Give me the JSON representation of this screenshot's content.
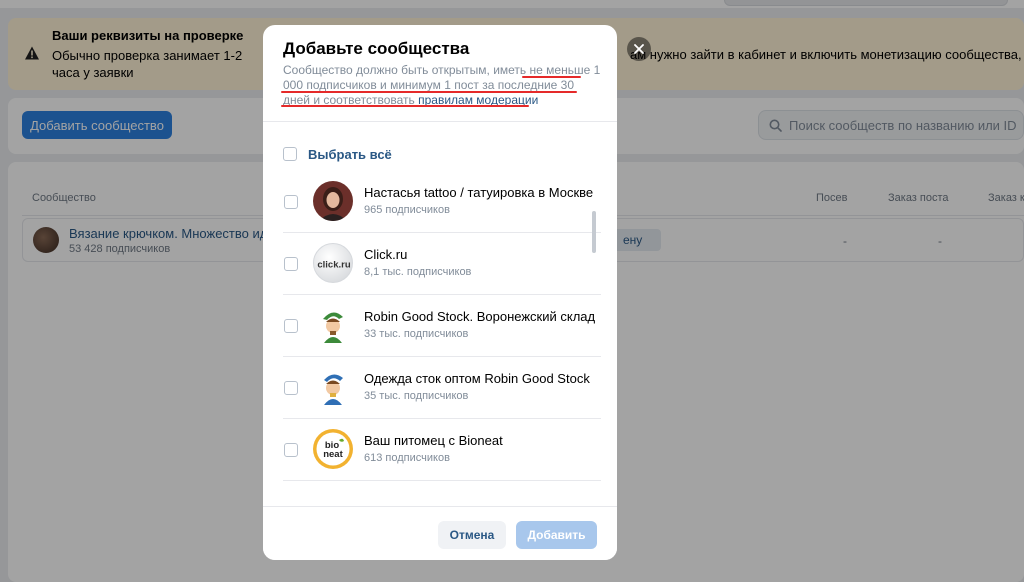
{
  "alert": {
    "title": "Ваши реквизиты на проверке",
    "body": "Обычно проверка занимает 1-2 часа у заявки",
    "body_right": "ам нужно зайти в кабинет и включить монетизацию сообщества, чтобы п"
  },
  "toolbar": {
    "add_label": "Добавить сообщество",
    "search_placeholder": "Поиск сообществ по названию или ID"
  },
  "table": {
    "headers": {
      "community": "Сообщество",
      "sowing": "Посев",
      "order_post": "Заказ поста",
      "order_more": "Заказ к"
    },
    "row": {
      "name": "Вязание крючком. Множество идей",
      "subs": "53 428 подписчиков",
      "tag": "ену",
      "dash": "-"
    }
  },
  "modal": {
    "title": "Добавьте сообщества",
    "desc_text": "Сообщество должно быть открытым, иметь не меньше 1 000 подписчиков и минимум 1 пост за последние 30 дней и соответствовать ",
    "desc_link": "правилам модерации",
    "select_all": "Выбрать всё",
    "items": [
      {
        "name": "Настасья tattoo / татуировка в Москве",
        "subs": "965 подписчиков",
        "avatar": "portrait-photo"
      },
      {
        "name": "Click.ru",
        "subs": "8,1 тыс. подписчиков",
        "avatar": "click-ru-logo",
        "logo_text": "click.ru"
      },
      {
        "name": "Robin Good Stock. Воронежский склад",
        "subs": "33 тыс. подписчиков",
        "avatar": "robin-mascot"
      },
      {
        "name": "Одежда сток оптом Robin Good Stock",
        "subs": "35 тыс. подписчиков",
        "avatar": "robin-mascot"
      },
      {
        "name": "Ваш питомец с Bioneat",
        "subs": "613 подписчиков",
        "avatar": "bioneat-logo",
        "logo_text": "bio neat"
      }
    ],
    "cancel": "Отмена",
    "submit": "Добавить"
  },
  "colors": {
    "primary": "#2d81e0",
    "link": "#2a5885",
    "annotation": "#e52a2a",
    "alert_bg": "#fff3d6"
  }
}
